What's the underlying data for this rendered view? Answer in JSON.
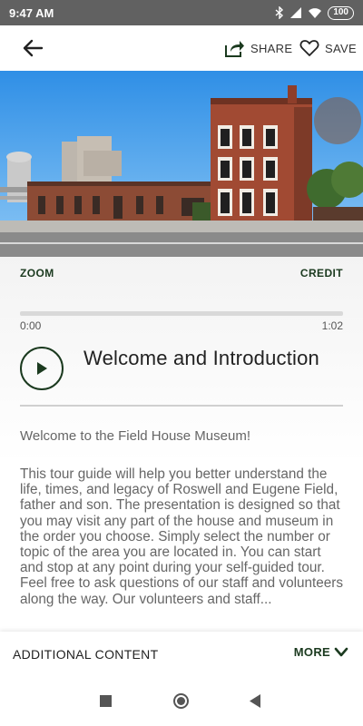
{
  "status_bar": {
    "time": "9:47 AM",
    "battery": "100"
  },
  "toolbar": {
    "share_label": "SHARE",
    "save_label": "SAVE"
  },
  "image_actions": {
    "zoom_label": "ZOOM",
    "credit_label": "CREDIT"
  },
  "player": {
    "current_time": "0:00",
    "duration": "1:02",
    "progress": 0,
    "track_title": "Welcome and Introduction"
  },
  "content": {
    "welcome": "Welcome to the Field House Museum!",
    "body": "This tour guide will help you better understand the life, times, and legacy of Roswell and Eugene Field, father and son. The presentation is designed so that you may visit any part of the house and museum in the order you choose. Simply select the number or topic of the area you are located in. You can start and stop at any point during your self-guided tour. Feel free to ask questions of our staff and volunteers along the way. Our volunteers and staff..."
  },
  "bottom_bar": {
    "additional_label": "ADDITIONAL CONTENT",
    "more_label": "MORE"
  },
  "colors": {
    "accent": "#1b3a1f",
    "status_bar": "#616161",
    "text": "#666666"
  }
}
